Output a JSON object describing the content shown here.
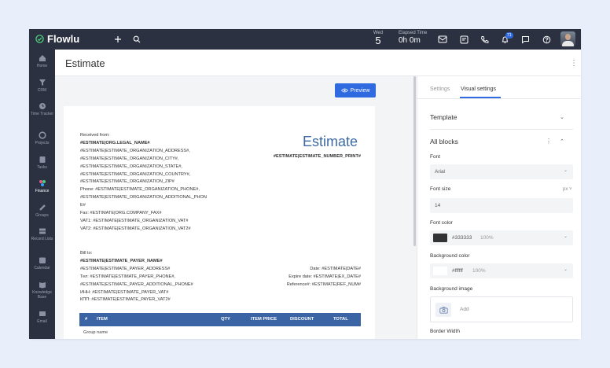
{
  "app": {
    "name": "Flowlu"
  },
  "topbar": {
    "date_dow": "Wed",
    "date_day": "5",
    "elapsed_label": "Elapsed Time",
    "elapsed_value": "0h 0m",
    "notification_count": "71"
  },
  "sidebar": {
    "items": [
      {
        "label": "Home"
      },
      {
        "label": "CRM"
      },
      {
        "label": "Time Tracker"
      },
      {
        "label": "Projects"
      },
      {
        "label": "Tasks"
      },
      {
        "label": "Finance"
      },
      {
        "label": "Groups"
      },
      {
        "label": "Record Lists"
      },
      {
        "label": "Calendar"
      },
      {
        "label": "Knowledge Base"
      },
      {
        "label": "Email"
      }
    ],
    "active": "Finance"
  },
  "page": {
    "title": "Estimate"
  },
  "preview": {
    "button_label": "Preview"
  },
  "document": {
    "title": "Estimate",
    "estimate_number": "#ESTIMATE|ESTIMATE_NUMBER_PRINT#",
    "received_from_label": "Received from:",
    "org_name": "#ESTIMATE|ORG.LEGAL_NAME#",
    "from_lines": [
      "#ESTIMATE|ESTIMATE_ORGANIZATION_ADDRESS#,",
      "#ESTIMATE|ESTIMATE_ORGANIZATION_CITY#,",
      "#ESTIMATE|ESTIMATE_ORGANIZATION_STATE#,",
      "#ESTIMATE|ESTIMATE_ORGANIZATION_COUNTRY#,",
      "#ESTIMATE|ESTIMATE_ORGANIZATION_ZIP#",
      "Phone: #ESTIMATE|ESTIMATE_ORGANIZATION_PHONE#,",
      "#ESTIMATE|ESTIMATE_ORGANIZATION_ADDITIONAL_PHON",
      "E#",
      "Fax: #ESTIMATE|ORG.COMPANY_FAX#",
      "VAT1: #ESTIMATE|ESTIMATE_ORGANIZATION_VAT#",
      "VAT2: #ESTIMATE|ESTIMATE_ORGANIZATION_VAT2#"
    ],
    "bill_to_label": "Bill to:",
    "payer_name": "#ESTIMATE|ESTIMATE_PAYER_NAME#",
    "bill_lines": [
      "#ESTIMATE|ESTIMATE_PAYER_ADDRESS#",
      "Тел: #ESTIMATE|ESTIMATE_PAYER_PHONE#,",
      "#ESTIMATE|ESTIMATE_PAYER_ADDITIONAL_PHONE#",
      "ИНН: #ESTIMATE|ESTIMATE_PAYER_VAT#",
      "КПП: #ESTIMATE|ESTIMATE_PAYER_VAT2#"
    ],
    "right_lines": [
      "Date: #ESTIMATE|DATE#",
      "Expire date: #ESTIMATE|EX_DATE#",
      "Reference#: #ESTIMATE|REF_NUM#"
    ],
    "table_headers": [
      "#",
      "ITEM",
      "QTY",
      "ITEM PRICE",
      "DISCOUNT",
      "TOTAL"
    ],
    "group_name": "Group name"
  },
  "panel": {
    "tabs": [
      {
        "label": "Settings",
        "active": false
      },
      {
        "label": "Visual settings",
        "active": true
      }
    ],
    "template_label": "Template",
    "all_blocks_label": "All blocks",
    "font_label": "Font",
    "font_value": "Arial",
    "font_size_label": "Font size",
    "font_size_unit": "px",
    "font_size_value": "14",
    "font_color_label": "Font color",
    "font_color_hex": "#333333",
    "font_color_opacity": "100%",
    "bg_color_label": "Background color",
    "bg_color_hex": "#ffffff",
    "bg_color_opacity": "100%",
    "bg_image_label": "Background image",
    "add_label": "Add",
    "border_width_label": "Border Width"
  },
  "colors": {
    "accent": "#2f6ae0",
    "topbar": "#2b3141",
    "doc_title": "#3d6aa3",
    "table_header": "#3a64a4",
    "font_swatch": "#333333",
    "bg_swatch": "#ffffff"
  }
}
